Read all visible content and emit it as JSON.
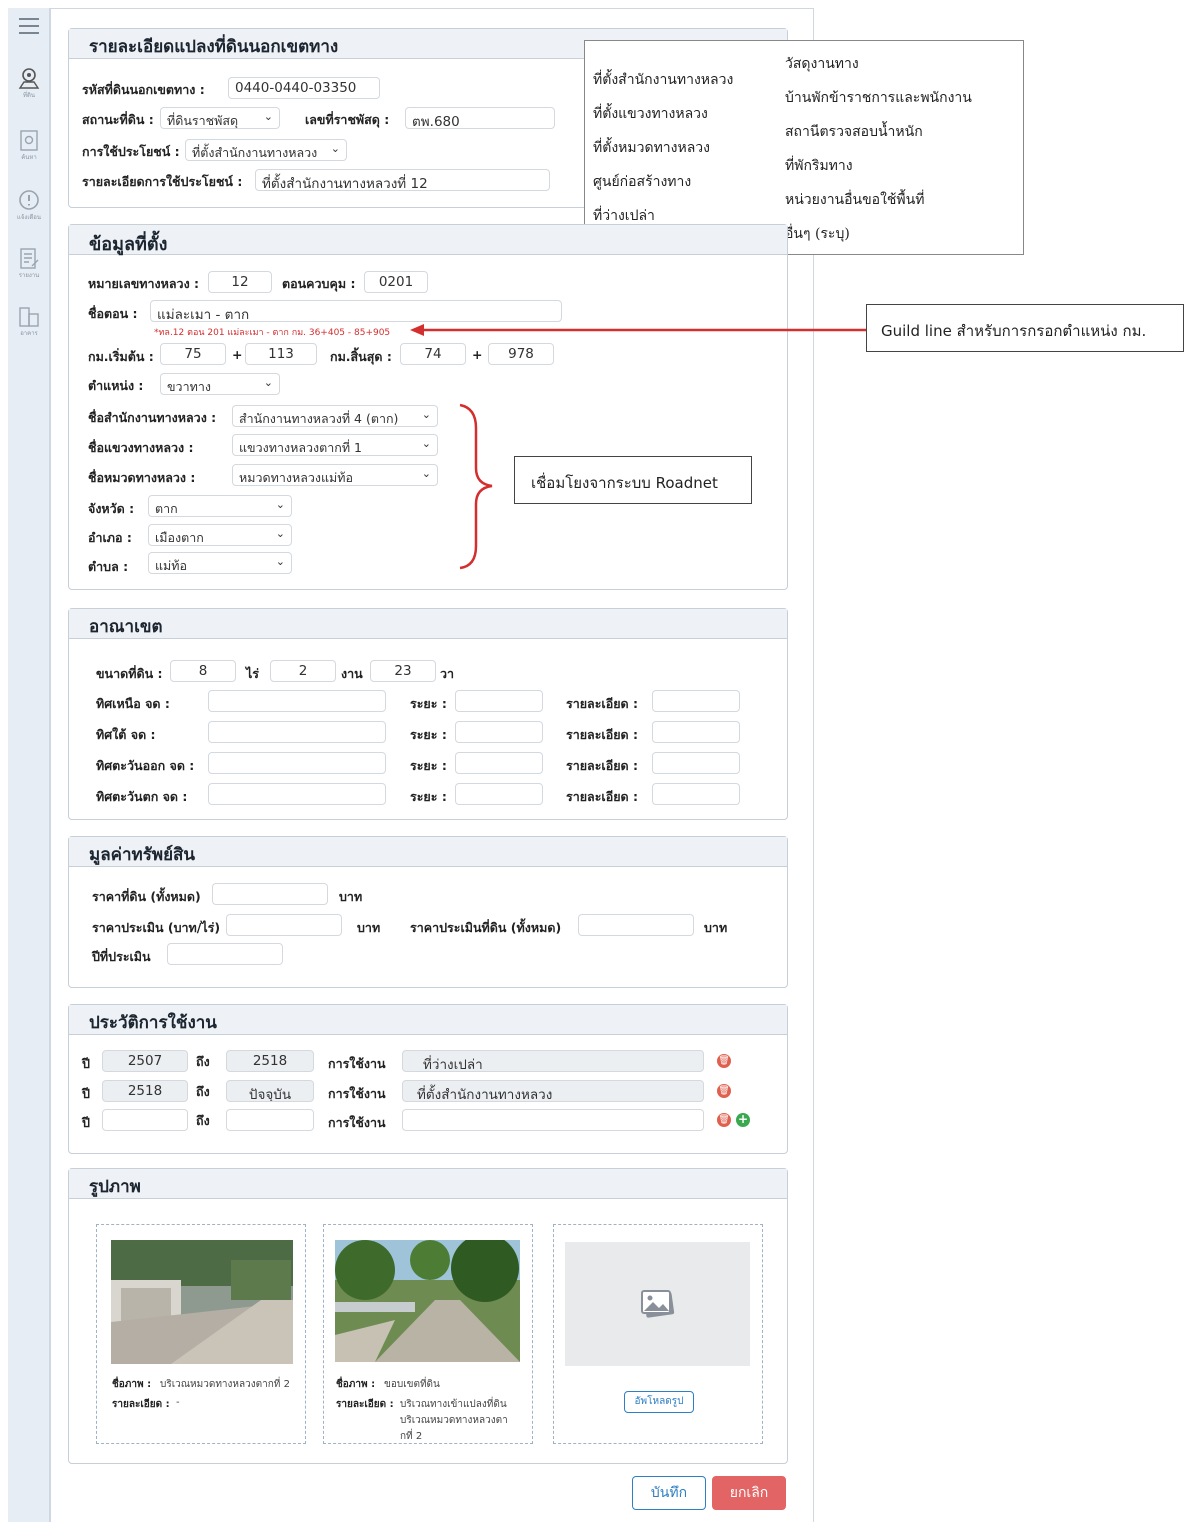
{
  "sidebar": {
    "items": [
      {
        "icon": "menu-icon"
      },
      {
        "icon": "map-pin-icon",
        "caption": "ที่ดิน"
      },
      {
        "icon": "document-search-icon",
        "caption": "ค้นหา"
      },
      {
        "icon": "alert-circle-icon",
        "caption": "แจ้งเตือน"
      },
      {
        "icon": "edit-document-icon",
        "caption": "รายงาน"
      },
      {
        "icon": "buildings-icon",
        "caption": "อาคาร"
      }
    ]
  },
  "detail": {
    "title": "รายละเอียดแปลงที่ดินนอกเขตทาง",
    "code_label": "รหัสที่ดินนอกเขตทาง :",
    "code_value": "0440-0440-03350",
    "status_label": "สถานะที่ดิน :",
    "status_value": "ที่ดินราชพัสดุ",
    "parcel_no_label": "เลขที่ราชพัสดุ :",
    "parcel_no_value": "ตพ.680",
    "usage_label": "การใช้ประโยชน์ :",
    "usage_value": "ที่ตั้งสำนักงานทางหลวง",
    "usage_detail_label": "รายละเอียดการใช้ประโยชน์ :",
    "usage_detail_value": "ที่ตั้งสำนักงานทางหลวงที่ 12"
  },
  "usage_options": {
    "left": [
      "ที่ตั้งสำนักงานทางหลวง",
      "ที่ตั้งแขวงทางหลวง",
      "ที่ตั้งหมวดทางหลวง",
      "ศูนย์ก่อสร้างทาง",
      "ที่ว่างเปล่า"
    ],
    "right": [
      "วัสดุงานทาง",
      "บ้านพักข้าราชการและพนักงาน",
      "สถานีตรวจสอบน้ำหนัก",
      "ที่พักริมทาง",
      "หน่วยงานอื่นขอใช้พื้นที่",
      "อื่นๆ (ระบุ)"
    ]
  },
  "location": {
    "title": "ข้อมูลที่ตั้ง",
    "highway_label": "หมายเลขทางหลวง :",
    "highway_value": "12",
    "section_ctrl_label": "ตอนควบคุม :",
    "section_ctrl_value": "0201",
    "section_name_label": "ชื่อตอน :",
    "section_name_value": "แม่ละเมา - ตาก",
    "hint": "*ทล.12 ตอน 201 แม่ละเมา - ตาก กม. 36+405 - 85+905",
    "km_start_label": "กม.เริ่มต้น :",
    "km_start_a": "75",
    "km_start_b": "113",
    "km_end_label": "กม.สิ้นสุด :",
    "km_end_a": "74",
    "km_end_b": "978",
    "plus": "+",
    "position_label": "ตำแหน่ง :",
    "position_value": "ขวาทาง",
    "office_label": "ชื่อสำนักงานทางหลวง :",
    "office_value": "สำนักงานทางหลวงที่ 4 (ตาก)",
    "district_label": "ชื่อแขวงทางหลวง :",
    "district_value": "แขวงทางหลวงตากที่ 1",
    "unit_label": "ชื่อหมวดทางหลวง :",
    "unit_value": "หมวดทางหลวงแม่ท้อ",
    "province_label": "จังหวัด :",
    "province_value": "ตาก",
    "amphoe_label": "อำเภอ :",
    "amphoe_value": "เมืองตาก",
    "tambon_label": "ตำบล :",
    "tambon_value": "แม่ท้อ"
  },
  "callouts": {
    "guideline": "Guild line สำหรับการกรอกตำแหน่ง กม.",
    "roadnet": "เชื่อมโยงจากระบบ  Roadnet"
  },
  "boundary": {
    "title": "อาณาเขต",
    "size_label": "ขนาดที่ดิน :",
    "rai_value": "8",
    "rai_unit": "ไร่",
    "ngan_value": "2",
    "ngan_unit": "งาน",
    "wa_value": "23",
    "wa_unit": "วา",
    "rows": [
      {
        "label": "ทิศเหนือ จด :"
      },
      {
        "label": "ทิศใต้ จด :"
      },
      {
        "label": "ทิศตะวันออก จด :"
      },
      {
        "label": "ทิศตะวันตก จด :"
      }
    ],
    "distance_label": "ระยะ :",
    "detail_label": "รายละเอียด :"
  },
  "value": {
    "title": "มูลค่าทรัพย์สิน",
    "land_price_label": "ราคาที่ดิน (ทั้งหมด)",
    "baht": "บาท",
    "appraise_rai_label": "ราคาประเมิน (บาท/ไร่)",
    "appraise_total_label": "ราคาประเมินที่ดิน (ทั้งหมด)",
    "appraise_year_label": "ปีที่ประเมิน"
  },
  "history": {
    "title": "ประวัติการใช้งาน",
    "year_label": "ปี",
    "to_label": "ถึง",
    "usage_label": "การใช้งาน",
    "rows": [
      {
        "from": "2507",
        "to": "2518",
        "usage": "ที่ว่างเปล่า"
      },
      {
        "from": "2518",
        "to": "ปัจจุบัน",
        "usage": "ที่ตั้งสำนักงานทางหลวง"
      },
      {
        "from": "",
        "to": "",
        "usage": ""
      }
    ]
  },
  "photos": {
    "title": "รูปภาพ",
    "name_label": "ชื่อภาพ :",
    "detail_label": "รายละเอียด :",
    "items": [
      {
        "name": "บริเวณหมวดทางหลวงตากที่ 2",
        "detail": "-"
      },
      {
        "name": "ขอบเขตที่ดิน",
        "detail_1": "บริเวณทางเข้าแปลงที่ดิน",
        "detail_2": "บริเวณหมวดทางหลวงตา",
        "detail_3": "กที่ 2"
      }
    ],
    "upload_label": "อัพโหลดรูป"
  },
  "actions": {
    "save": "บันทึก",
    "cancel": "ยกเลิก"
  },
  "colors": {
    "accent": "#2e7fc4",
    "danger": "#e05a5a",
    "annotation_red": "#d32f2f"
  }
}
